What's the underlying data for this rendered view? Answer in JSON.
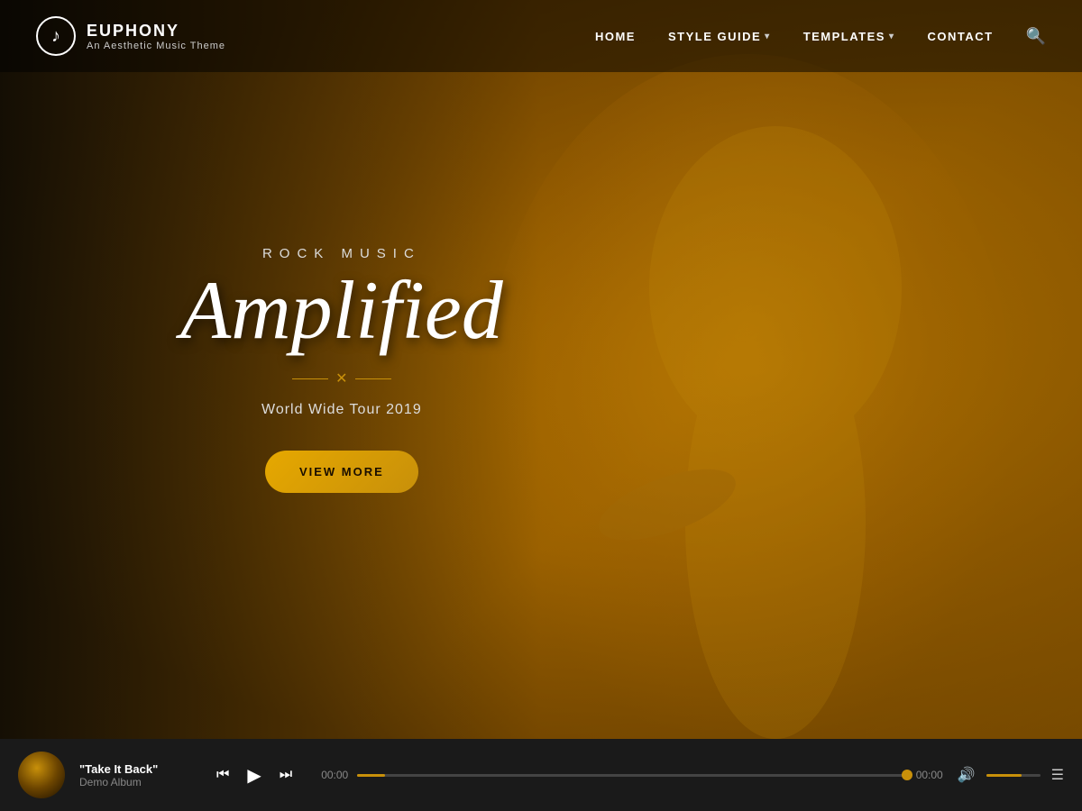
{
  "brand": {
    "name": "EUPHONY",
    "tagline": "An Aesthetic Music Theme",
    "logo_symbol": "♪"
  },
  "nav": {
    "items": [
      {
        "label": "HOME",
        "active": true,
        "has_dropdown": false
      },
      {
        "label": "STYLE GUIDE",
        "active": false,
        "has_dropdown": true
      },
      {
        "label": "TEMPLATES",
        "active": false,
        "has_dropdown": true
      },
      {
        "label": "CONTACT",
        "active": false,
        "has_dropdown": false
      }
    ],
    "search_label": "🔍"
  },
  "hero": {
    "subtitle": "ROCK MUSIC",
    "title": "Amplified",
    "divider_symbol": "✕",
    "tour_text": "World Wide Tour 2019",
    "cta_label": "VIEW MORE",
    "accent_color": "#c8900a"
  },
  "player": {
    "album_art_alt": "Demo Album art",
    "song_title": "\"Take It Back\"",
    "album_name": "Demo Album",
    "time_current": "00:00",
    "time_total": "00:00",
    "progress_percent": 5,
    "volume_percent": 65,
    "controls": {
      "prev": "⏮",
      "play": "▶",
      "next": "⏭"
    }
  },
  "colors": {
    "accent": "#c8900a",
    "bg_dark": "#1a1a1a",
    "hero_overlay": "rgba(0,0,0,0.55)"
  }
}
